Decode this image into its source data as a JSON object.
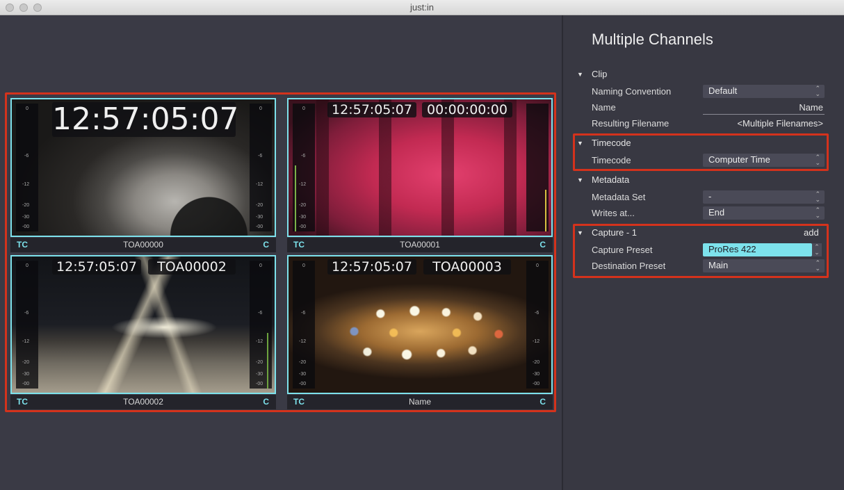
{
  "window": {
    "title": "just:in"
  },
  "channels": [
    {
      "timecode": "12:57:05:07",
      "second_box": "",
      "name": "TOA00000",
      "tc_label": "TC",
      "c_label": "C"
    },
    {
      "timecode": "12:57:05:07",
      "second_box": "00:00:00:00",
      "name": "TOA00001",
      "tc_label": "TC",
      "c_label": "C"
    },
    {
      "timecode": "12:57:05:07",
      "second_box": "TOA00002",
      "name": "TOA00002",
      "tc_label": "TC",
      "c_label": "C"
    },
    {
      "timecode": "12:57:05:07",
      "second_box": "TOA00003",
      "name": "Name",
      "tc_label": "TC",
      "c_label": "C"
    }
  ],
  "meter_ticks": [
    "0",
    "-6",
    "-12",
    "-20",
    "-30",
    "-00"
  ],
  "panel": {
    "title": "Multiple Channels",
    "clip": {
      "heading": "Clip",
      "naming_label": "Naming Convention",
      "naming_value": "Default",
      "name_label": "Name",
      "name_value": "Name",
      "resulting_label": "Resulting Filename",
      "resulting_value": "<Multiple Filenames>"
    },
    "timecode": {
      "heading": "Timecode",
      "label": "Timecode",
      "value": "Computer Time"
    },
    "metadata": {
      "heading": "Metadata",
      "set_label": "Metadata Set",
      "set_value": "-",
      "writes_label": "Writes at...",
      "writes_value": "End"
    },
    "capture": {
      "heading": "Capture - 1",
      "add_label": "add",
      "preset_label": "Capture Preset",
      "preset_value": "ProRes 422",
      "dest_label": "Destination Preset",
      "dest_value": "Main"
    }
  },
  "colors": {
    "accent": "#7de2ec",
    "highlight_border": "#d4321c"
  }
}
